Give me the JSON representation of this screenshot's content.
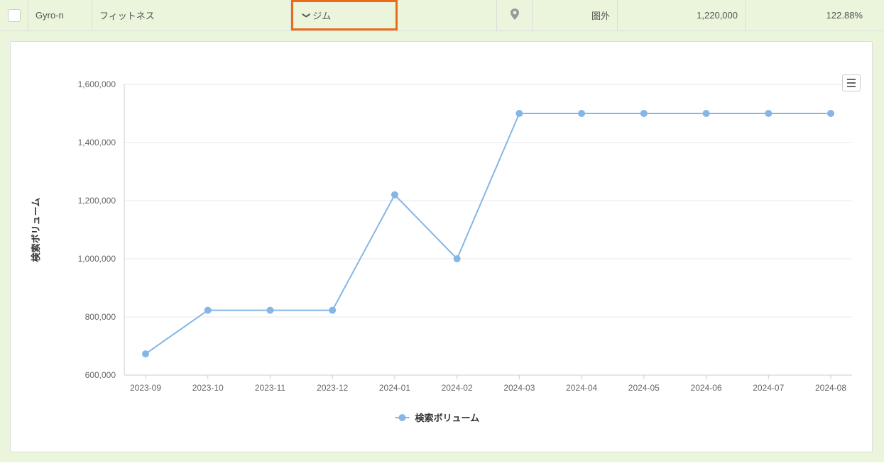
{
  "row": {
    "name": "Gyro-n",
    "group": "フィットネス",
    "keyword": "ジム",
    "rank": "圏外",
    "volume": "1,220,000",
    "percent": "122.88%"
  },
  "chart_data": {
    "type": "line",
    "series_name": "検索ボリューム",
    "ylabel": "検索ボリューム",
    "ylim": [
      600000,
      1600000
    ],
    "yticks": [
      600000,
      800000,
      1000000,
      1200000,
      1400000,
      1600000
    ],
    "ytick_labels": [
      "600,000",
      "800,000",
      "1,000,000",
      "1,200,000",
      "1,400,000",
      "1,600,000"
    ],
    "categories": [
      "2023-09",
      "2023-10",
      "2023-11",
      "2023-12",
      "2024-01",
      "2024-02",
      "2024-03",
      "2024-04",
      "2024-05",
      "2024-06",
      "2024-07",
      "2024-08"
    ],
    "values": [
      673000,
      823000,
      823000,
      823000,
      1220000,
      1000000,
      1500000,
      1500000,
      1500000,
      1500000,
      1500000,
      1500000
    ]
  }
}
